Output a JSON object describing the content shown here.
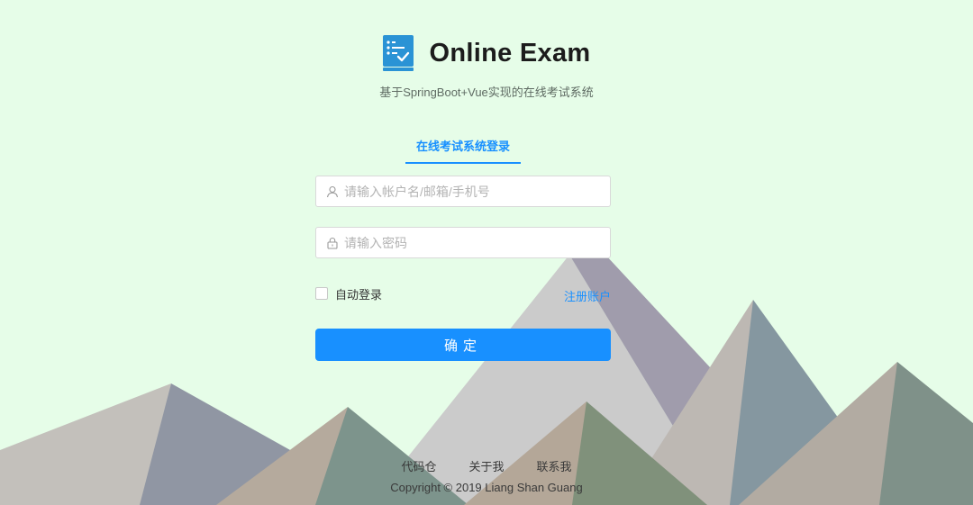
{
  "app": {
    "title": "Online Exam",
    "subtitle": "基于SpringBoot+Vue实现的在线考试系统",
    "logo_icon": "checklist-document-icon"
  },
  "login": {
    "tab_label": "在线考试系统登录",
    "username_placeholder": "请输入帐户名/邮箱/手机号",
    "username_value": "",
    "username_icon": "user-icon",
    "password_placeholder": "请输入密码",
    "password_value": "",
    "password_icon": "lock-icon",
    "remember_label": "自动登录",
    "remember_checked": false,
    "register_link": "注册账户",
    "submit_label": "确定"
  },
  "footer": {
    "links": [
      "代码仓",
      "关于我",
      "联系我"
    ],
    "copyright": "Copyright © 2019 Liang Shan Guang"
  },
  "colors": {
    "background": "#e6fde8",
    "accent": "#1890ff",
    "logo": "#2a93d5"
  }
}
